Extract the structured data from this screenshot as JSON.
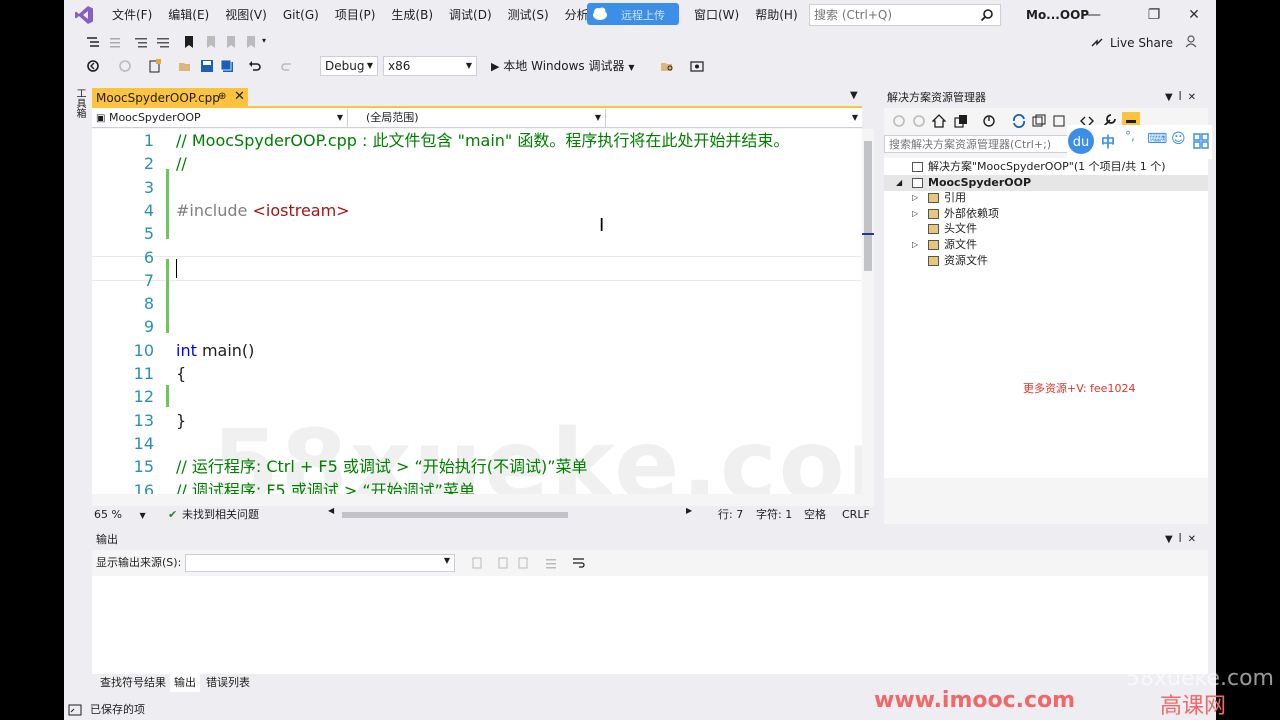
{
  "menu": {
    "items": [
      "文件(F)",
      "编辑(E)",
      "视图(V)",
      "Git(G)",
      "项目(P)",
      "生成(B)",
      "调试(D)",
      "测试(S)",
      "分析(N)"
    ],
    "cloud_label": "远程上传",
    "items2": [
      "窗口(W)",
      "帮助(H)"
    ]
  },
  "search": {
    "placeholder": "搜索 (Ctrl+Q)"
  },
  "window": {
    "title": "Mo...OOP",
    "minimize": "—",
    "restore": "❐",
    "close": "✕"
  },
  "toolbar": {
    "config": "Debug",
    "platform": "x86",
    "run_label": "本地 Windows 调试器",
    "live_share": "Live Share"
  },
  "toolbox": {
    "label": "工具箱"
  },
  "editor": {
    "tab_name": "MoocSpyderOOP.cpp",
    "tab_pin": "⊕",
    "tab_close": "✕",
    "nav_project": "MoocSpyderOOP",
    "nav_scope": "(全局范围)",
    "nav_member": "",
    "lines": [
      {
        "num": "1",
        "text": "// MoocSpyderOOP.cpp : 此文件包含 \"main\" 函数。程序执行将在此处开始并结束。",
        "kind": "comment"
      },
      {
        "num": "2",
        "text": "//",
        "kind": "comment"
      },
      {
        "num": "3",
        "text": "",
        "kind": "plain"
      },
      {
        "num": "4",
        "text": "",
        "kind": "include",
        "pre": "#include ",
        "inc": "<iostream>"
      },
      {
        "num": "5",
        "text": "",
        "kind": "plain"
      },
      {
        "num": "6",
        "text": "",
        "kind": "plain"
      },
      {
        "num": "7",
        "text": "",
        "kind": "plain"
      },
      {
        "num": "8",
        "text": "",
        "kind": "plain"
      },
      {
        "num": "9",
        "text": "",
        "kind": "plain"
      },
      {
        "num": "10",
        "text": "",
        "kind": "func",
        "kw": "int",
        "rest": " main()"
      },
      {
        "num": "11",
        "text": "{",
        "kind": "plain"
      },
      {
        "num": "12",
        "text": "",
        "kind": "plain"
      },
      {
        "num": "13",
        "text": "}",
        "kind": "plain"
      },
      {
        "num": "14",
        "text": "",
        "kind": "plain"
      },
      {
        "num": "15",
        "text": "// 运行程序: Ctrl + F5 或调试 > “开始执行(不调试)”菜单",
        "kind": "comment"
      },
      {
        "num": "16",
        "text": "// 调试程序: F5 或调试 > “开始调试”菜单",
        "kind": "comment"
      }
    ],
    "watermark": "58xueke.com"
  },
  "editor_status": {
    "zoom": "65 %",
    "issues": "未找到相关问题",
    "line": "行: 7",
    "col": "字符: 1",
    "space": "空格",
    "eol": "CRLF"
  },
  "solution_explorer": {
    "title": "解决方案资源管理器",
    "search_placeholder": "搜索解决方案资源管理器(Ctrl+;)",
    "tree": [
      {
        "label": "解决方案\"MoocSpyderOOP\"(1 个项目/共 1 个)",
        "level": 0,
        "expander": "",
        "bold": false
      },
      {
        "label": "MoocSpyderOOP",
        "level": 1,
        "expander": "◢",
        "bold": true
      },
      {
        "label": "引用",
        "level": 2,
        "expander": "▷",
        "bold": false
      },
      {
        "label": "外部依赖项",
        "level": 2,
        "expander": "▷",
        "bold": false
      },
      {
        "label": "头文件",
        "level": 2,
        "expander": "",
        "bold": false
      },
      {
        "label": "源文件",
        "level": 2,
        "expander": "▷",
        "bold": false
      },
      {
        "label": "资源文件",
        "level": 2,
        "expander": "",
        "bold": false
      }
    ],
    "promo": "更多资源+V: fee1024"
  },
  "output": {
    "title": "输出",
    "source_label": "显示输出来源(S):",
    "source_value": ""
  },
  "bottom_tabs": [
    "查找符号结果",
    "输出",
    "错误列表"
  ],
  "statusbar": {
    "text": "已保存的项"
  },
  "overlays": {
    "imooc": "www.imooc.com",
    "xueke": "58xueke.com",
    "gaokewang": "高课网"
  },
  "colors": {
    "accent_tab": "#fbc33e",
    "comment": "#008000",
    "keyword": "#0000ff",
    "line_number": "#2b91af",
    "change_bar": "#6bc65b"
  }
}
